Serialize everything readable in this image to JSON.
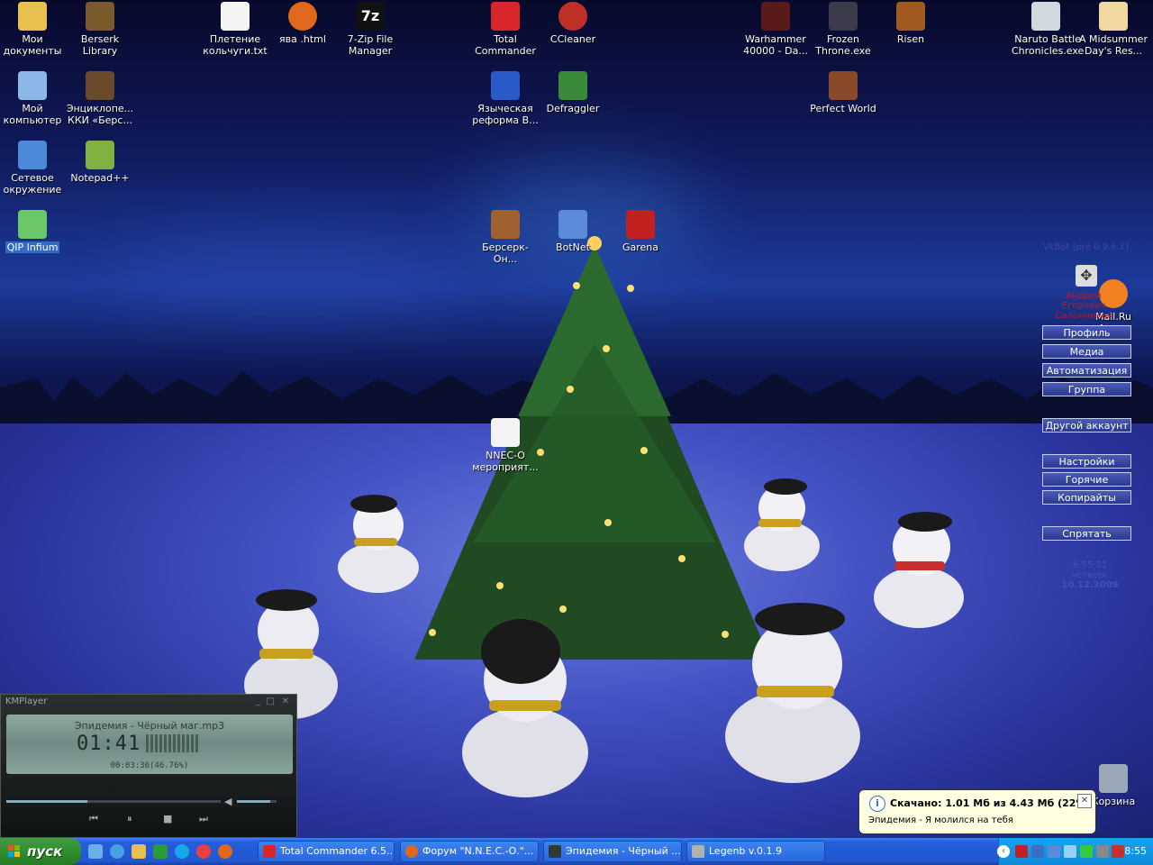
{
  "desktop_icons": [
    {
      "label": "Мои документы",
      "color": "#e8c050"
    },
    {
      "label": "Berserk Library",
      "color": "#7a5a2a"
    },
    {
      "label": "Плетение кольчуги.txt",
      "color": "#f4f4f4"
    },
    {
      "label": "ява .html",
      "color": "#e0681c"
    },
    {
      "label": "7-Zip File Manager",
      "color": "#111111"
    },
    {
      "label": "Total Commander",
      "color": "#d8262a"
    },
    {
      "label": "CCleaner",
      "color": "#c03028"
    },
    {
      "label": "Warhammer 40000 - Da...",
      "color": "#5a1a1a"
    },
    {
      "label": "Frozen Throne.exe",
      "color": "#3a3a4a"
    },
    {
      "label": "Risen",
      "color": "#a05a20"
    },
    {
      "label": "Naruto Battle Chronicles.exe",
      "color": "#d0d8e0"
    },
    {
      "label": "A Midsummer Day's Res...",
      "color": "#f0d8a0"
    },
    {
      "label": "Мой компьютер",
      "color": "#8cb8e8"
    },
    {
      "label": "Энциклопе... ККИ «Берс...",
      "color": "#6a4a2a"
    },
    {
      "label": "Языческая реформа В...",
      "color": "#2a5ac8"
    },
    {
      "label": "Defraggler",
      "color": "#3a8a3a"
    },
    {
      "label": "Perfect World",
      "color": "#8a4a2a"
    },
    {
      "label": "Сетевое окружение",
      "color": "#4a8ad8"
    },
    {
      "label": "Notepad++",
      "color": "#80b040"
    },
    {
      "label": "QIP Infium",
      "color": "#6ac86a"
    },
    {
      "label": "Берсерк-Он...",
      "color": "#a06030"
    },
    {
      "label": "BotNet",
      "color": "#5a8ad8"
    },
    {
      "label": "Garena",
      "color": "#c02020"
    },
    {
      "label": "NNEC-О мероприят...",
      "color": "#f4f4f4"
    },
    {
      "label": "Mail.Ru Агент",
      "color": "#f08020"
    },
    {
      "label": "Корзина",
      "color": "#9aa8b8"
    }
  ],
  "vkbot": {
    "title": "VkBot [pre 0.9.6.1]",
    "user": "Андрей Егорович Салонников",
    "buttons": [
      "Профиль",
      "Медиа",
      "Автоматизация",
      "Группа",
      "Другой аккаунт",
      "Настройки",
      "Горячие клавиши",
      "Копирайты",
      "Спрятать"
    ],
    "time": "8:55:21",
    "weekday": "четверг",
    "date": "10.12.2009"
  },
  "kmplayer": {
    "title": "KMPlayer",
    "track": "Эпидемия - Чёрный маг.mp3",
    "time": "01:41",
    "sub": "00:03:36(46.76%)",
    "progress": 0.38,
    "volume": 0.85
  },
  "balloon": {
    "title": "Скачано: 1.01 Мб из 4.43 Мб (22%)",
    "text": "Эпидемия - Я молился на тебя",
    "close": "✕",
    "info": "i"
  },
  "taskbar": {
    "start_label": "пуск",
    "quick_launch": [
      {
        "name": "quick-launch-1",
        "color": "#6ab0e8"
      },
      {
        "name": "quick-launch-2",
        "color": "#48a0e0"
      },
      {
        "name": "quick-launch-3",
        "color": "#e8c050"
      },
      {
        "name": "quick-launch-4",
        "color": "#2a9a3a"
      },
      {
        "name": "quick-launch-5",
        "color": "#18a8e8"
      },
      {
        "name": "quick-launch-6",
        "color": "#e84040"
      },
      {
        "name": "quick-launch-7",
        "color": "#e0681c"
      }
    ],
    "tasks": [
      {
        "label": "Total Commander 6.5...",
        "color": "#d8262a"
      },
      {
        "label": "Форум \"N.N.E.C.-О.\"...",
        "color": "#e0681c"
      },
      {
        "label": "Эпидемия - Чёрный ...",
        "color": "#303838"
      },
      {
        "label": "Legenb v.0.1.9",
        "color": "#b0b0b0"
      }
    ],
    "clock": "8:55"
  }
}
